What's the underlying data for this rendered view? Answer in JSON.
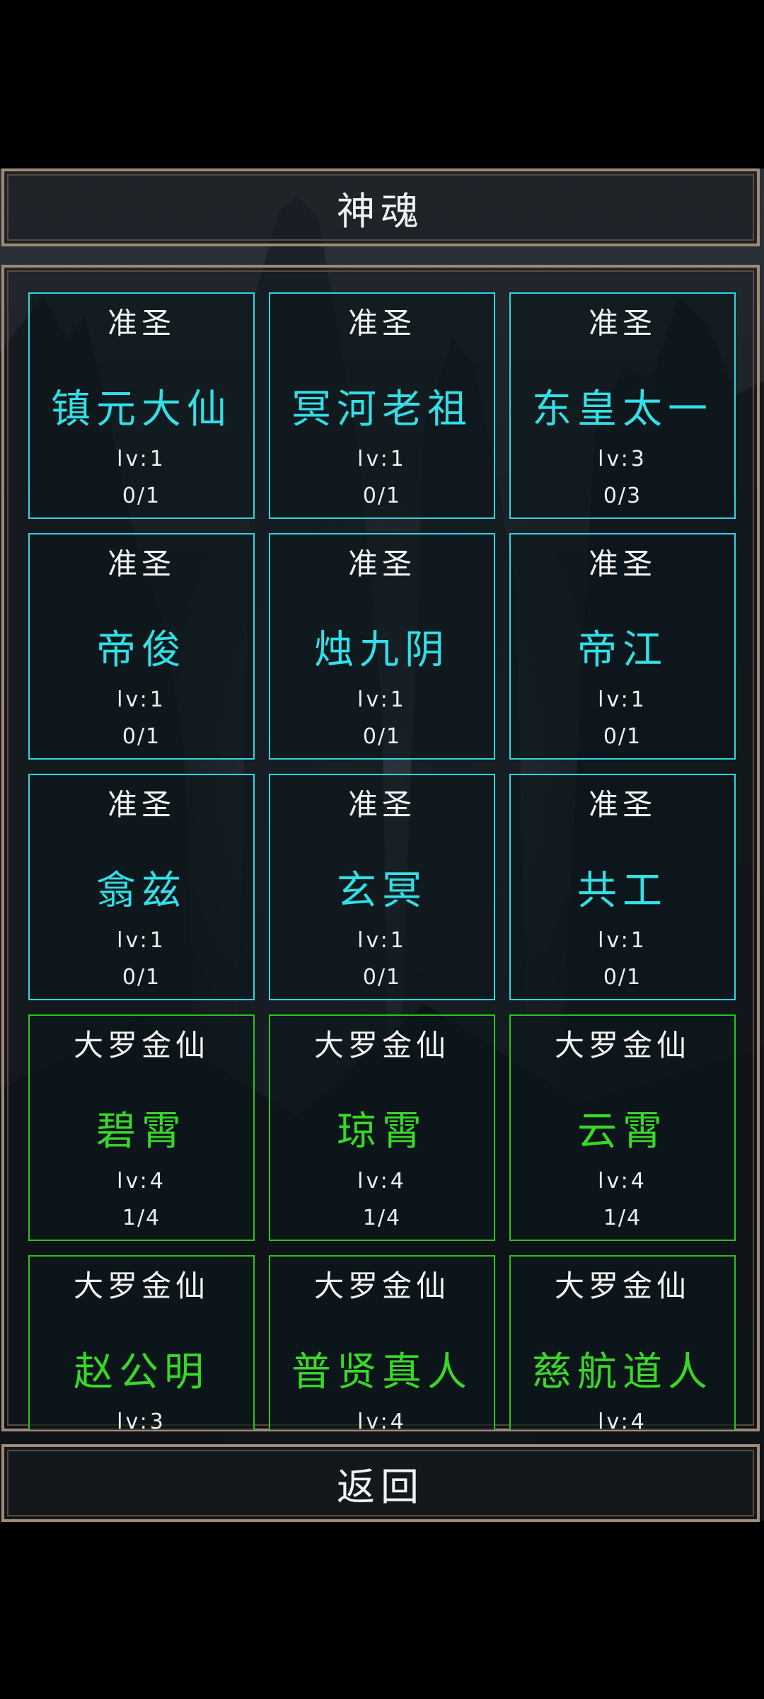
{
  "header": {
    "title": "神魂"
  },
  "cards": [
    {
      "rank": "准圣",
      "name": "镇元大仙",
      "level": "lv:1",
      "progress": "0/1",
      "tier": "cyan"
    },
    {
      "rank": "准圣",
      "name": "冥河老祖",
      "level": "lv:1",
      "progress": "0/1",
      "tier": "cyan"
    },
    {
      "rank": "准圣",
      "name": "东皇太一",
      "level": "lv:3",
      "progress": "0/3",
      "tier": "cyan"
    },
    {
      "rank": "准圣",
      "name": "帝俊",
      "level": "lv:1",
      "progress": "0/1",
      "tier": "cyan"
    },
    {
      "rank": "准圣",
      "name": "烛九阴",
      "level": "lv:1",
      "progress": "0/1",
      "tier": "cyan"
    },
    {
      "rank": "准圣",
      "name": "帝江",
      "level": "lv:1",
      "progress": "0/1",
      "tier": "cyan"
    },
    {
      "rank": "准圣",
      "name": "翕兹",
      "level": "lv:1",
      "progress": "0/1",
      "tier": "cyan"
    },
    {
      "rank": "准圣",
      "name": "玄冥",
      "level": "lv:1",
      "progress": "0/1",
      "tier": "cyan"
    },
    {
      "rank": "准圣",
      "name": "共工",
      "level": "lv:1",
      "progress": "0/1",
      "tier": "cyan"
    },
    {
      "rank": "大罗金仙",
      "name": "碧霄",
      "level": "lv:4",
      "progress": "1/4",
      "tier": "green"
    },
    {
      "rank": "大罗金仙",
      "name": "琼霄",
      "level": "lv:4",
      "progress": "1/4",
      "tier": "green"
    },
    {
      "rank": "大罗金仙",
      "name": "云霄",
      "level": "lv:4",
      "progress": "1/4",
      "tier": "green"
    },
    {
      "rank": "大罗金仙",
      "name": "赵公明",
      "level": "lv:3",
      "progress": "",
      "tier": "green"
    },
    {
      "rank": "大罗金仙",
      "name": "普贤真人",
      "level": "lv:4",
      "progress": "",
      "tier": "green"
    },
    {
      "rank": "大罗金仙",
      "name": "慈航道人",
      "level": "lv:4",
      "progress": "",
      "tier": "green"
    }
  ],
  "colors": {
    "cyan": "#2ed6e0",
    "green": "#27c51d",
    "frame": "#a08a75"
  },
  "footer": {
    "back_label": "返回"
  }
}
